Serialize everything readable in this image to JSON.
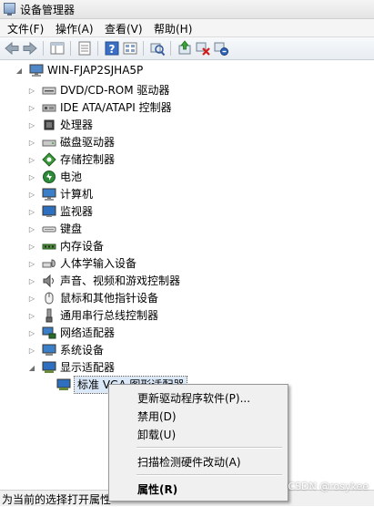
{
  "window": {
    "title": "设备管理器"
  },
  "menubar": [
    {
      "label": "文件(F)"
    },
    {
      "label": "操作(A)"
    },
    {
      "label": "查看(V)"
    },
    {
      "label": "帮助(H)"
    }
  ],
  "toolbar": [
    {
      "icon": "back-arrow-icon"
    },
    {
      "icon": "forward-arrow-icon"
    },
    {
      "icon": "show-hide-tree-icon"
    },
    {
      "icon": "properties-icon"
    },
    {
      "icon": "help-icon"
    },
    {
      "icon": "view-icon"
    },
    {
      "icon": "scan-hardware-icon"
    },
    {
      "icon": "update-driver-icon"
    },
    {
      "icon": "disable-device-icon"
    },
    {
      "icon": "uninstall-device-icon"
    }
  ],
  "tree": {
    "root": {
      "label": "WIN-FJAP2SJHA5P",
      "icon": "computer-icon",
      "expanded": true
    },
    "categories": [
      {
        "label": "DVD/CD-ROM 驱动器",
        "icon": "dvd-drive-icon"
      },
      {
        "label": "IDE ATA/ATAPI 控制器",
        "icon": "ide-controller-icon"
      },
      {
        "label": "处理器",
        "icon": "processor-icon"
      },
      {
        "label": "磁盘驱动器",
        "icon": "disk-drive-icon"
      },
      {
        "label": "存储控制器",
        "icon": "storage-controller-icon"
      },
      {
        "label": "电池",
        "icon": "battery-icon"
      },
      {
        "label": "计算机",
        "icon": "computer-icon"
      },
      {
        "label": "监视器",
        "icon": "monitor-icon"
      },
      {
        "label": "键盘",
        "icon": "keyboard-icon"
      },
      {
        "label": "内存设备",
        "icon": "memory-icon"
      },
      {
        "label": "人体学输入设备",
        "icon": "hid-icon"
      },
      {
        "label": "声音、视频和游戏控制器",
        "icon": "sound-icon"
      },
      {
        "label": "鼠标和其他指针设备",
        "icon": "mouse-icon"
      },
      {
        "label": "通用串行总线控制器",
        "icon": "usb-icon"
      },
      {
        "label": "网络适配器",
        "icon": "network-adapter-icon"
      },
      {
        "label": "系统设备",
        "icon": "system-devices-icon"
      },
      {
        "label": "显示适配器",
        "icon": "display-adapter-icon",
        "expanded": true
      }
    ],
    "child": {
      "label": "标准 VGA 图形适配器",
      "icon": "display-adapter-icon",
      "selected": true
    }
  },
  "context_menu": {
    "items": [
      {
        "label": "更新驱动程序软件(P)...",
        "separator_after": false
      },
      {
        "label": "禁用(D)",
        "separator_after": false
      },
      {
        "label": "卸载(U)",
        "separator_after": true
      },
      {
        "label": "扫描检测硬件改动(A)",
        "separator_after": true
      },
      {
        "label": "属性(R)",
        "bold": true,
        "separator_after": false
      }
    ]
  },
  "statusbar": {
    "text": "为当前的选择打开属性"
  },
  "watermark": {
    "text": "CSDN @rosykee"
  },
  "colors": {
    "selection": "#dbe8f8",
    "menu_bg": "#f0f0f0",
    "toolbar_bg": "#e8edf2"
  }
}
